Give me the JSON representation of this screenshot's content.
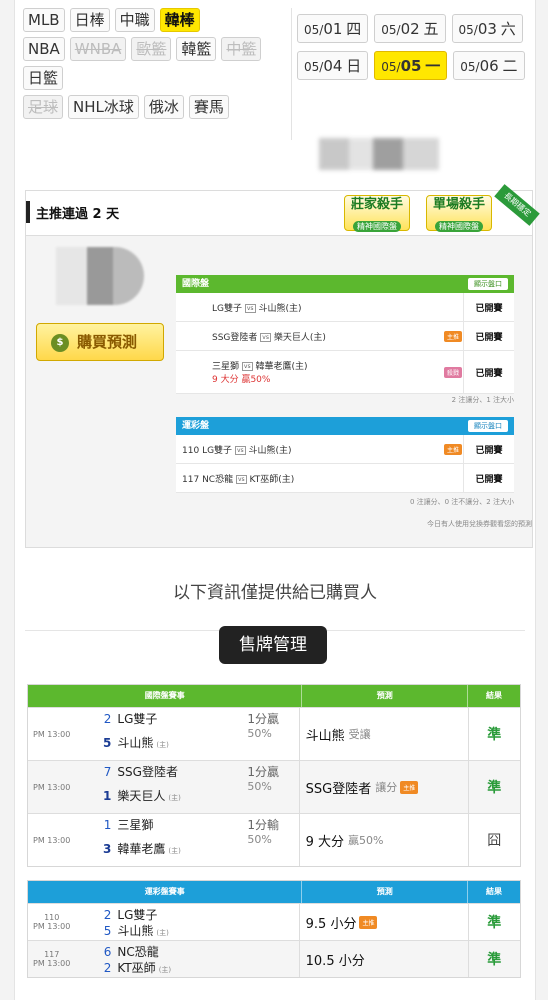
{
  "leagues": [
    [
      {
        "label": "MLB",
        "state": ""
      },
      {
        "label": "日棒",
        "state": ""
      },
      {
        "label": "中職",
        "state": ""
      },
      {
        "label": "韓棒",
        "state": "active"
      }
    ],
    [
      {
        "label": "NBA",
        "state": ""
      },
      {
        "label": "WNBA",
        "state": "disabled"
      },
      {
        "label": "歐籃",
        "state": "disabled"
      },
      {
        "label": "韓籃",
        "state": ""
      },
      {
        "label": "中籃",
        "state": "disabled"
      }
    ],
    [
      {
        "label": "日籃",
        "state": ""
      }
    ],
    [
      {
        "label": "足球",
        "state": "disabled"
      },
      {
        "label": "NHL冰球",
        "state": ""
      },
      {
        "label": "俄冰",
        "state": ""
      },
      {
        "label": "賽馬",
        "state": ""
      }
    ]
  ],
  "dates": [
    [
      {
        "md": "05/",
        "d": "01",
        "wd": "四",
        "active": false
      },
      {
        "md": "05/",
        "d": "02",
        "wd": "五",
        "active": false
      },
      {
        "md": "05/",
        "d": "03",
        "wd": "六",
        "active": false
      }
    ],
    [
      {
        "md": "05/",
        "d": "04",
        "wd": "日",
        "active": false
      },
      {
        "md": "05/",
        "d": "05",
        "wd": "一",
        "active": true
      },
      {
        "md": "05/",
        "d": "06",
        "wd": "二",
        "active": false
      }
    ]
  ],
  "promo": {
    "title": "主推連過 2 天",
    "badge1": {
      "main": "莊家殺手",
      "sub": "精神國際盤"
    },
    "badge2": {
      "main": "單場殺手",
      "sub": "精神國際盤"
    },
    "ribbon": "長期穩定",
    "buy_label": "購買預測",
    "intl": {
      "header": "國際盤",
      "pill": "顯示盤口",
      "rows": [
        {
          "match": "LG雙子",
          "vs": "vs",
          "away": "斗山熊(主)",
          "sub": "",
          "tag": "",
          "status": "已開賽"
        },
        {
          "match": "SSG登陸者",
          "vs": "vs",
          "away": "樂天巨人(主)",
          "sub": "",
          "tag": "主推",
          "status": "已開賽"
        },
        {
          "match": "三星獅",
          "vs": "vs",
          "away": "韓華老鷹(主)",
          "sub": "9 大分 贏50%",
          "tag": "殺戮",
          "status": "已開賽"
        }
      ],
      "note": "2 注讓分、1 注大小"
    },
    "lottery": {
      "header": "運彩盤",
      "pill": "顯示盤口",
      "rows": [
        {
          "no": "110",
          "match": "LG雙子",
          "vs": "vs",
          "away": "斗山熊(主)",
          "tag": "主推",
          "status": "已開賽"
        },
        {
          "no": "117",
          "match": "NC恐龍",
          "vs": "vs",
          "away": "KT巫師(主)",
          "tag": "",
          "status": "已開賽"
        }
      ],
      "note": "0 注讓分、0 注不讓分、2 注大小",
      "note2": "今日有人使用兌換券觀看您的預測"
    }
  },
  "info_banner": "以下資訊僅提供給已購買人",
  "sell_button": "售牌管理",
  "intl_results": {
    "headers": [
      "國際盤賽事",
      "預測",
      "結果"
    ],
    "rows": [
      {
        "time": "PM 13:00",
        "s1": "2",
        "t1": "LG雙子",
        "s2": "5",
        "t2": "斗山熊",
        "home": "(主)",
        "line1": "1分贏",
        "line2": "50%",
        "pick": "斗山熊",
        "pick_soft": "受讓",
        "tag": "",
        "result": "準"
      },
      {
        "time": "PM 13:00",
        "s1": "7",
        "t1": "SSG登陸者",
        "s2": "1",
        "t2": "樂天巨人",
        "home": "(主)",
        "line1": "1分贏",
        "line2": "50%",
        "pick": "SSG登陸者",
        "pick_soft": "讓分",
        "tag": "主推",
        "result": "準"
      },
      {
        "time": "PM 13:00",
        "s1": "1",
        "t1": "三星獅",
        "s2": "3",
        "t2": "韓華老鷹",
        "home": "(主)",
        "line1": "1分輸",
        "line2": "50%",
        "pick": "9 大分",
        "pick_soft": "贏50%",
        "tag": "",
        "result": "囧"
      }
    ]
  },
  "lottery_results": {
    "headers": [
      "運彩盤賽事",
      "預測",
      "結果"
    ],
    "rows": [
      {
        "no": "110",
        "time": "PM 13:00",
        "s1": "2",
        "t1": "LG雙子",
        "s2": "5",
        "t2": "斗山熊",
        "home": "(主)",
        "pick": "9.5 小分",
        "tag": "主推",
        "result": "準"
      },
      {
        "no": "117",
        "time": "PM 13:00",
        "s1": "6",
        "t1": "NC恐龍",
        "s2": "2",
        "t2": "KT巫師",
        "home": "(主)",
        "pick": "10.5 小分",
        "tag": "",
        "result": "準"
      }
    ]
  }
}
